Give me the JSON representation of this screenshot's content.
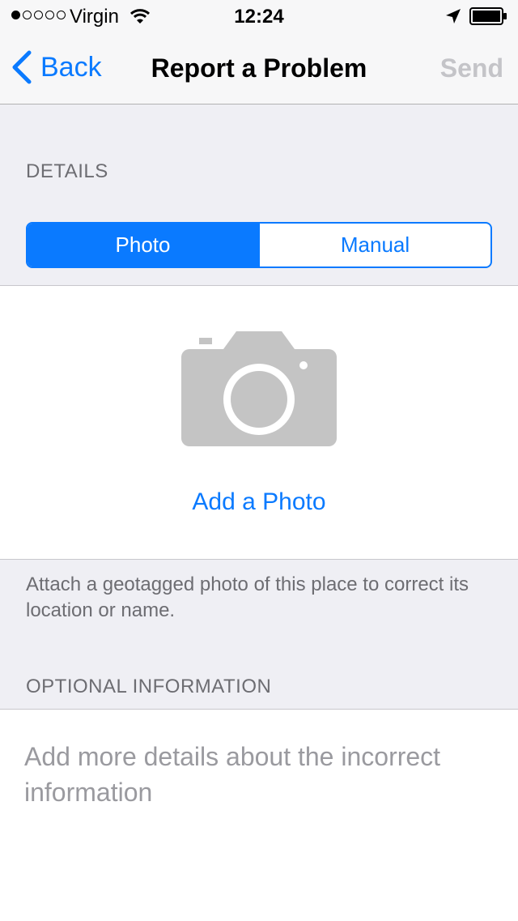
{
  "status_bar": {
    "carrier": "Virgin",
    "time": "12:24",
    "signal_strength": 1,
    "signal_max": 5
  },
  "nav": {
    "back_label": "Back",
    "title": "Report a Problem",
    "send_label": "Send"
  },
  "details": {
    "header": "DETAILS",
    "segments": [
      "Photo",
      "Manual"
    ],
    "selected_segment": "Photo"
  },
  "photo": {
    "add_label": "Add a Photo",
    "footer": "Attach a geotagged photo of this place to correct its location or name."
  },
  "optional": {
    "header": "OPTIONAL INFORMATION",
    "placeholder": "Add more details about the incorrect information"
  },
  "colors": {
    "accent": "#0a7aff",
    "grouped_background": "#efeff4",
    "disabled_text": "#c4c4c8",
    "icon_gray": "#c4c4c4"
  },
  "icons": [
    "wifi-icon",
    "location-arrow-icon",
    "battery-icon",
    "chevron-left-icon",
    "camera-icon"
  ]
}
